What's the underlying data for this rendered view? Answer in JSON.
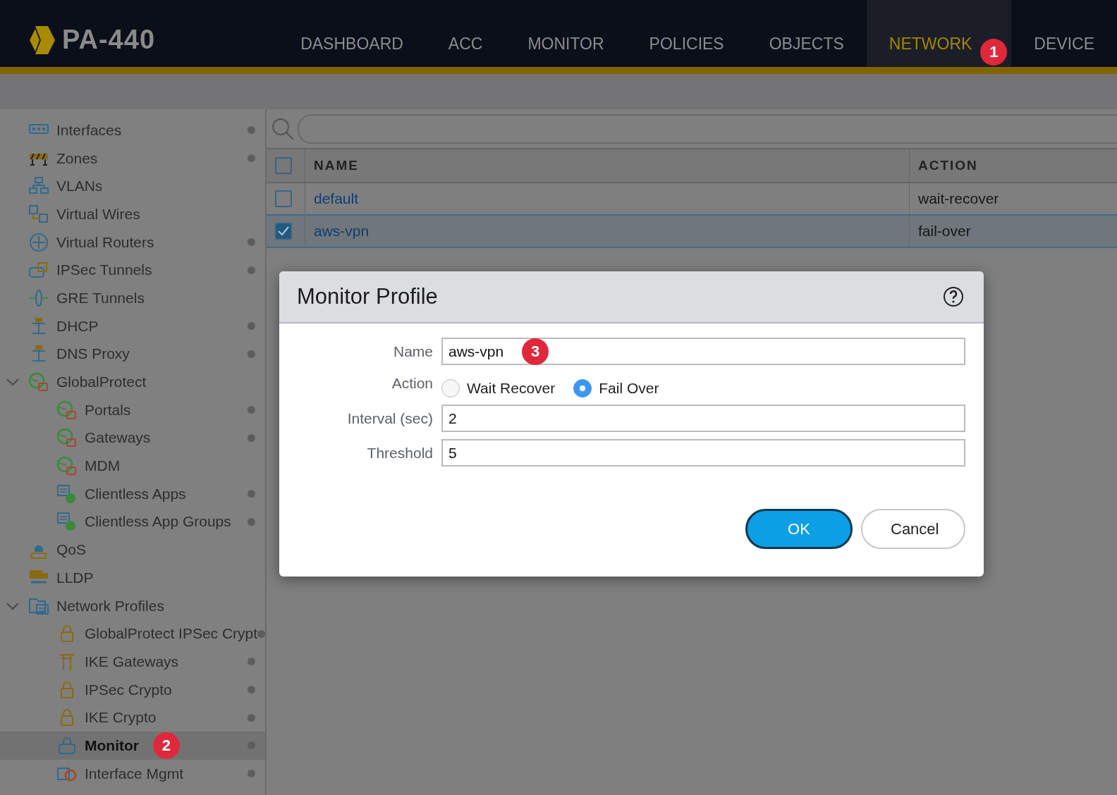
{
  "app": {
    "logo_text": "PA-440"
  },
  "nav": [
    {
      "label": "DASHBOARD",
      "selected": false
    },
    {
      "label": "ACC",
      "selected": false
    },
    {
      "label": "MONITOR",
      "selected": false
    },
    {
      "label": "POLICIES",
      "selected": false
    },
    {
      "label": "OBJECTS",
      "selected": false
    },
    {
      "label": "NETWORK",
      "selected": true,
      "badge": "1"
    },
    {
      "label": "DEVICE",
      "selected": false
    }
  ],
  "sidebar": {
    "items": [
      {
        "label": "Interfaces",
        "kind": "ports",
        "dot": true,
        "selected": false
      },
      {
        "label": "Zones",
        "kind": "barrier",
        "dot": true,
        "selected": false
      },
      {
        "label": "VLANs",
        "kind": "hierarchy",
        "dot": false,
        "selected": false
      },
      {
        "label": "Virtual Wires",
        "kind": "wires",
        "dot": false,
        "selected": false
      },
      {
        "label": "Virtual Routers",
        "kind": "router",
        "dot": true,
        "selected": false
      },
      {
        "label": "IPSec Tunnels",
        "kind": "tunnel",
        "dot": true,
        "selected": false
      },
      {
        "label": "GRE Tunnels",
        "kind": "gre",
        "dot": false,
        "selected": false
      },
      {
        "label": "DHCP",
        "kind": "dhcp",
        "dot": true,
        "selected": false
      },
      {
        "label": "DNS Proxy",
        "kind": "dhcp",
        "dot": true,
        "selected": false
      },
      {
        "label": "GlobalProtect",
        "kind": "globe",
        "dot": false,
        "selected": false,
        "expanded": true,
        "children": [
          {
            "label": "Portals",
            "kind": "globe",
            "dot": true,
            "selected": false
          },
          {
            "label": "Gateways",
            "kind": "globe",
            "dot": true,
            "selected": false
          },
          {
            "label": "MDM",
            "kind": "globe",
            "dot": false,
            "selected": false
          },
          {
            "label": "Clientless Apps",
            "kind": "list",
            "dot": true,
            "selected": false
          },
          {
            "label": "Clientless App Groups",
            "kind": "list",
            "dot": true,
            "selected": false
          }
        ]
      },
      {
        "label": "QoS",
        "kind": "qos",
        "dot": false,
        "selected": false
      },
      {
        "label": "LLDP",
        "kind": "truck",
        "dot": false,
        "selected": false
      },
      {
        "label": "Network Profiles",
        "kind": "folder",
        "dot": false,
        "selected": false,
        "expanded": true,
        "children": [
          {
            "label": "GlobalProtect IPSec Crypt",
            "kind": "lock",
            "dot": true,
            "selected": false
          },
          {
            "label": "IKE Gateways",
            "kind": "gate",
            "dot": true,
            "selected": false
          },
          {
            "label": "IPSec Crypto",
            "kind": "lock",
            "dot": true,
            "selected": false
          },
          {
            "label": "IKE Crypto",
            "kind": "lock",
            "dot": true,
            "selected": false
          },
          {
            "label": "Monitor",
            "kind": "monitor",
            "dot": true,
            "selected": true,
            "badge": "2"
          },
          {
            "label": "Interface Mgmt",
            "kind": "gear",
            "dot": true,
            "selected": false
          }
        ]
      }
    ]
  },
  "table": {
    "columns": [
      "NAME",
      "ACTION"
    ],
    "select_all_checked": false,
    "rows": [
      {
        "name": "default",
        "action": "wait-recover",
        "selected": false
      },
      {
        "name": "aws-vpn",
        "action": "fail-over",
        "selected": true
      }
    ]
  },
  "dialog": {
    "title": "Monitor Profile",
    "fields": [
      {
        "kind": "text",
        "label": "Name",
        "value": "aws-vpn",
        "badge": "3"
      },
      {
        "kind": "radio",
        "label": "Action",
        "options": [
          {
            "label": "Wait Recover",
            "selected": false
          },
          {
            "label": "Fail Over",
            "selected": true
          }
        ]
      },
      {
        "kind": "text",
        "label": "Interval (sec)",
        "value": "2"
      },
      {
        "kind": "text",
        "label": "Threshold",
        "value": "5"
      }
    ],
    "buttons": [
      {
        "label": "OK",
        "kind": "primary"
      },
      {
        "label": "Cancel",
        "kind": "secondary"
      }
    ]
  }
}
